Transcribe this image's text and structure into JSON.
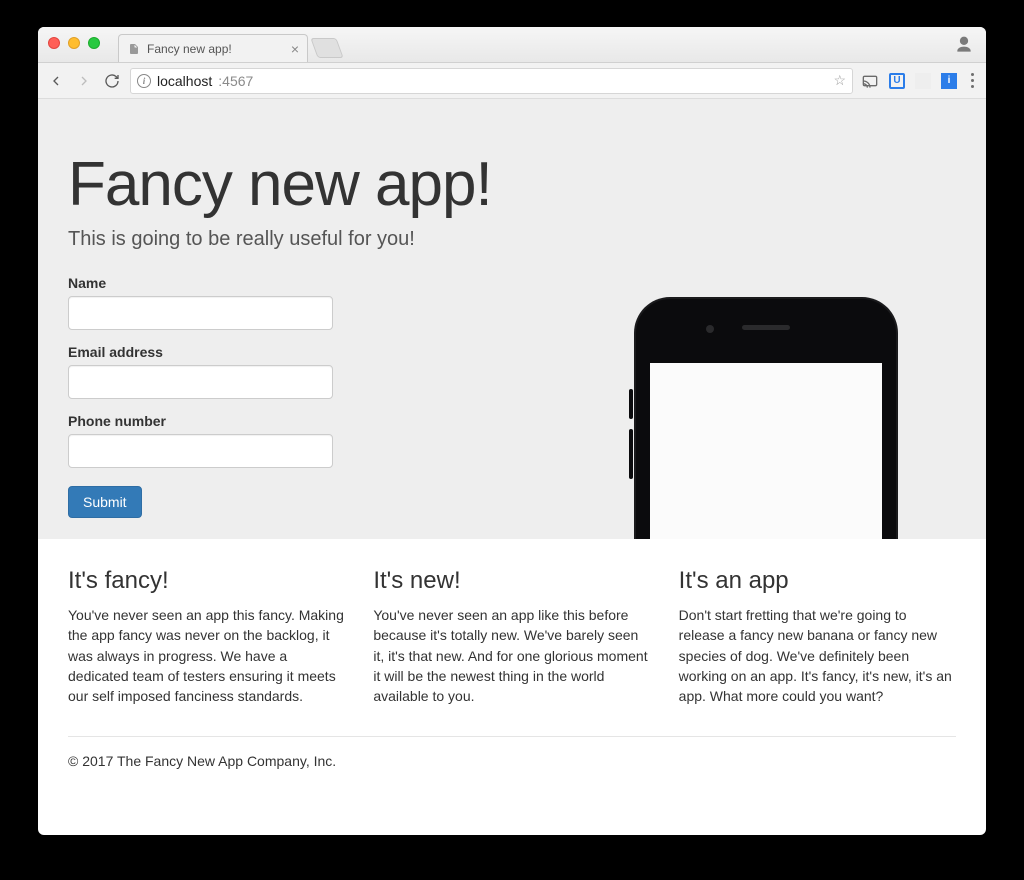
{
  "browser": {
    "tab_title": "Fancy new app!",
    "url_host": "localhost",
    "url_port": ":4567"
  },
  "hero": {
    "title": "Fancy new app!",
    "lead": "This is going to be really useful for you!"
  },
  "form": {
    "name_label": "Name",
    "email_label": "Email address",
    "phone_label": "Phone number",
    "submit_label": "Submit"
  },
  "features": [
    {
      "title": "It's fancy!",
      "body": "You've never seen an app this fancy. Making the app fancy was never on the backlog, it was always in progress. We have a dedicated team of testers ensuring it meets our self imposed fanciness standards."
    },
    {
      "title": "It's new!",
      "body": "You've never seen an app like this before because it's totally new. We've barely seen it, it's that new. And for one glorious moment it will be the newest thing in the world available to you."
    },
    {
      "title": "It's an app",
      "body": "Don't start fretting that we're going to release a fancy new banana or fancy new species of dog. We've definitely been working on an app. It's fancy, it's new, it's an app. What more could you want?"
    }
  ],
  "footer": {
    "text": "© 2017 The Fancy New App Company, Inc."
  }
}
